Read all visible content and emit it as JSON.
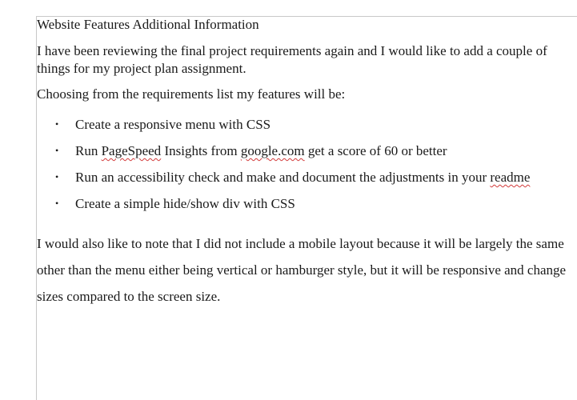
{
  "document": {
    "title": "Website Features Additional Information",
    "paragraph1": "I have been reviewing the final project requirements again and I would like to add a couple of things for my project plan assignment.",
    "paragraph2": "Choosing from the requirements list my features will be:",
    "features": [
      {
        "parts": [
          "Create a responsive menu with CSS"
        ]
      },
      {
        "parts": [
          "Run ",
          "PageSpeed",
          " Insights from ",
          "google.com",
          " get a score of 60 or better"
        ]
      },
      {
        "parts": [
          "Run an accessibility check and make and document the adjustments in your ",
          "readme"
        ]
      },
      {
        "parts": [
          "Create a simple hide/show div with CSS"
        ]
      }
    ],
    "bullet_char": "•",
    "paragraph3": "I would also like to note that I did not include a mobile layout because it will be largely the same other than the menu either being vertical or hamburger style, but it will be responsive and change sizes compared to the screen size."
  }
}
